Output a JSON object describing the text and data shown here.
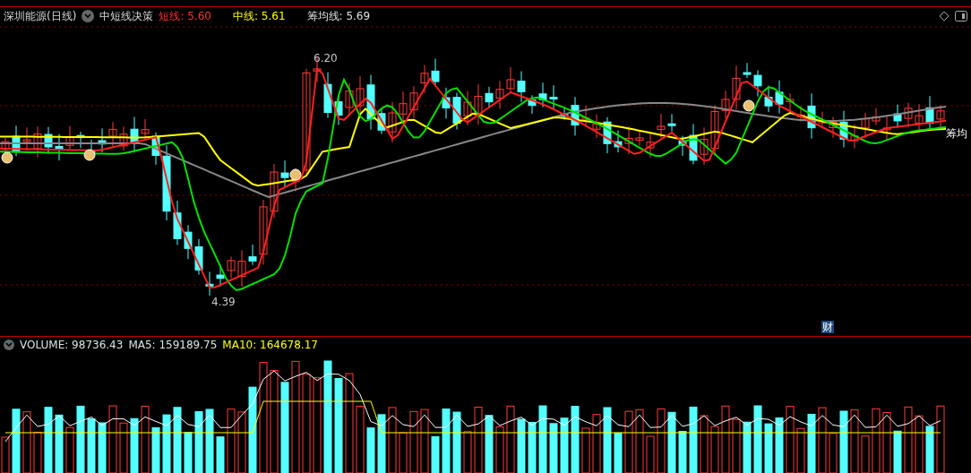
{
  "chart_header": {
    "title": "深圳能源(日线)",
    "indicator": "中短线决策",
    "readings": [
      {
        "label": "短线: 5.60",
        "color": "#ff3030"
      },
      {
        "label": "中线: 5.61",
        "color": "#ffff00"
      },
      {
        "label": "筹均线: 5.69",
        "color": "#e0e0e0"
      }
    ]
  },
  "price_labels": [
    {
      "text": "6.20",
      "kind": "high"
    },
    {
      "text": "4.39",
      "kind": "low"
    },
    {
      "text": "筹均",
      "kind": "line"
    }
  ],
  "event_badge": "财",
  "volume_header": {
    "readings": [
      {
        "label": "VOLUME: 98736.43",
        "color": "#e0e0e0"
      },
      {
        "label": "MA5: 159189.75",
        "color": "#e0e0e0"
      },
      {
        "label": "MA10: 164678.17",
        "color": "#ffff00"
      }
    ]
  }
}
